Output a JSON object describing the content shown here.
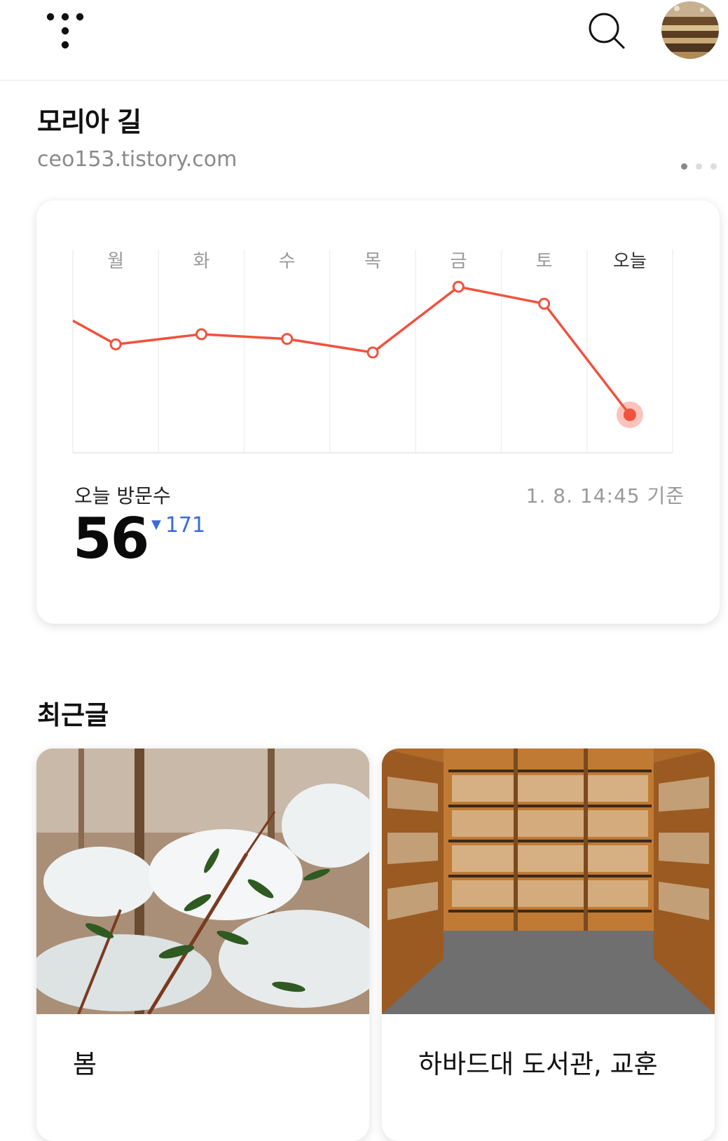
{
  "header": {
    "logo_icon": "tistory-logo-icon",
    "search_icon": "search-icon",
    "avatar_icon": "profile-avatar"
  },
  "blog": {
    "title": "모리아 길",
    "url": "ceo153.tistory.com"
  },
  "stats": {
    "visit_label": "오늘 방문수",
    "visit_count": "56",
    "delta_value": "171",
    "delta_direction": "down",
    "timestamp": "1. 8. 14:45 기준",
    "line_color": "#f0523f"
  },
  "chart_data": {
    "type": "line",
    "categories": [
      "월",
      "화",
      "수",
      "목",
      "금",
      "토",
      "오늘"
    ],
    "series": [
      {
        "values": [
          160,
          175,
          168,
          148,
          245,
          220,
          56
        ]
      }
    ],
    "incoming_value": 195,
    "ylim": [
      0,
      300
    ]
  },
  "recent": {
    "title": "최근글",
    "posts": [
      {
        "title": "봄"
      },
      {
        "title": "하바드대 도서관, 교훈"
      }
    ]
  }
}
